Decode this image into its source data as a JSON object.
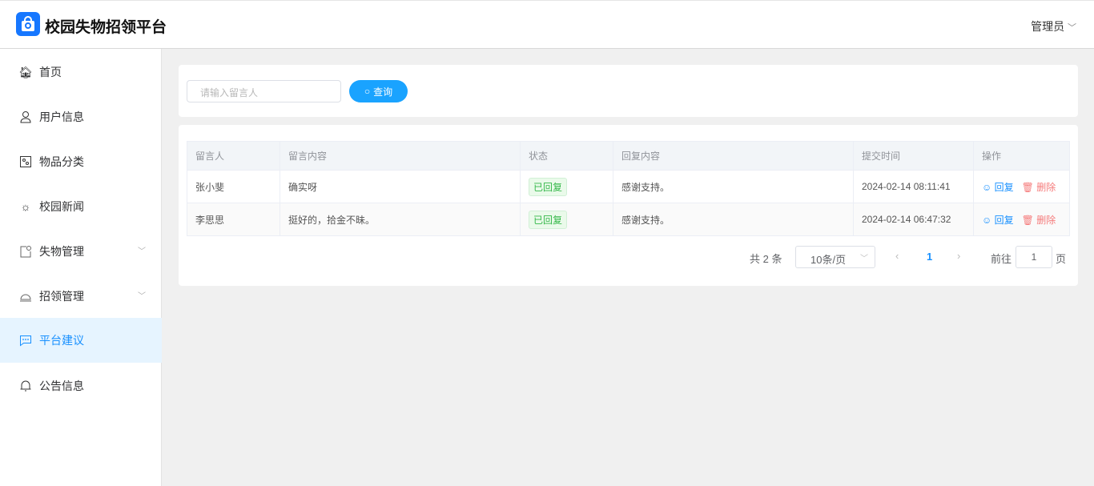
{
  "header": {
    "title": "校园失物招领平台",
    "user": "管理员"
  },
  "sidebar": {
    "items": [
      {
        "label": "首页"
      },
      {
        "label": "用户信息"
      },
      {
        "label": "物品分类"
      },
      {
        "label": "校园新闻"
      },
      {
        "label": "失物管理"
      },
      {
        "label": "招领管理"
      },
      {
        "label": "平台建议"
      },
      {
        "label": "公告信息"
      }
    ]
  },
  "search": {
    "placeholder": "请输入留言人",
    "button": "查询"
  },
  "table": {
    "headers": [
      "留言人",
      "留言内容",
      "状态",
      "回复内容",
      "提交时间",
      "操作"
    ],
    "rows": [
      {
        "name": "张小斐",
        "content": "确实呀",
        "status": "已回复",
        "reply": "感谢支持。",
        "time": "2024-02-14 08:11:41"
      },
      {
        "name": "李思思",
        "content": "挺好的，拾金不昧。",
        "status": "已回复",
        "reply": "感谢支持。",
        "time": "2024-02-14 06:47:32"
      }
    ],
    "reply_action": "回复",
    "delete_action": "删除"
  },
  "pagination": {
    "total": "共 2 条",
    "page_size": "10条/页",
    "current": "1",
    "goto_prefix": "前往",
    "goto_value": "1",
    "goto_suffix": "页"
  },
  "colors": {
    "accent": "#1890ff",
    "active_bg": "#e6f4ff"
  }
}
